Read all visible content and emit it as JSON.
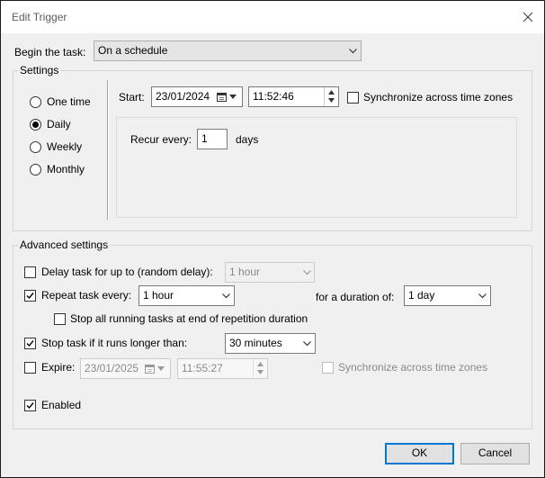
{
  "window": {
    "title": "Edit Trigger"
  },
  "begin": {
    "label": "Begin the task:",
    "value": "On a schedule"
  },
  "settings": {
    "legend": "Settings",
    "schedules": [
      {
        "label": "One time",
        "selected": false
      },
      {
        "label": "Daily",
        "selected": true
      },
      {
        "label": "Weekly",
        "selected": false
      },
      {
        "label": "Monthly",
        "selected": false
      }
    ],
    "start_label": "Start:",
    "start_date": "23/01/2024",
    "start_time": "11:52:46",
    "sync_label": "Synchronize across time zones",
    "sync_checked": false,
    "recur_label": "Recur every:",
    "recur_value": "1",
    "recur_unit": "days"
  },
  "advanced": {
    "legend": "Advanced settings",
    "delay": {
      "label": "Delay task for up to (random delay):",
      "value": "1 hour",
      "checked": false
    },
    "repeat": {
      "label": "Repeat task every:",
      "value": "1 hour",
      "checked": true,
      "duration_label": "for a duration of:",
      "duration_value": "1 day"
    },
    "stop_running": {
      "label": "Stop all running tasks at end of repetition duration",
      "checked": false
    },
    "stop_longer": {
      "label": "Stop task if it runs longer than:",
      "value": "30 minutes",
      "checked": true
    },
    "expire": {
      "label": "Expire:",
      "date": "23/01/2025",
      "time": "11:55:27",
      "checked": false,
      "sync_label": "Synchronize across time zones"
    },
    "enabled": {
      "label": "Enabled",
      "checked": true
    }
  },
  "buttons": {
    "ok": "OK",
    "cancel": "Cancel"
  },
  "colors": {
    "accent": "#0078d7",
    "dialog_bg": "#f0f0f0"
  }
}
